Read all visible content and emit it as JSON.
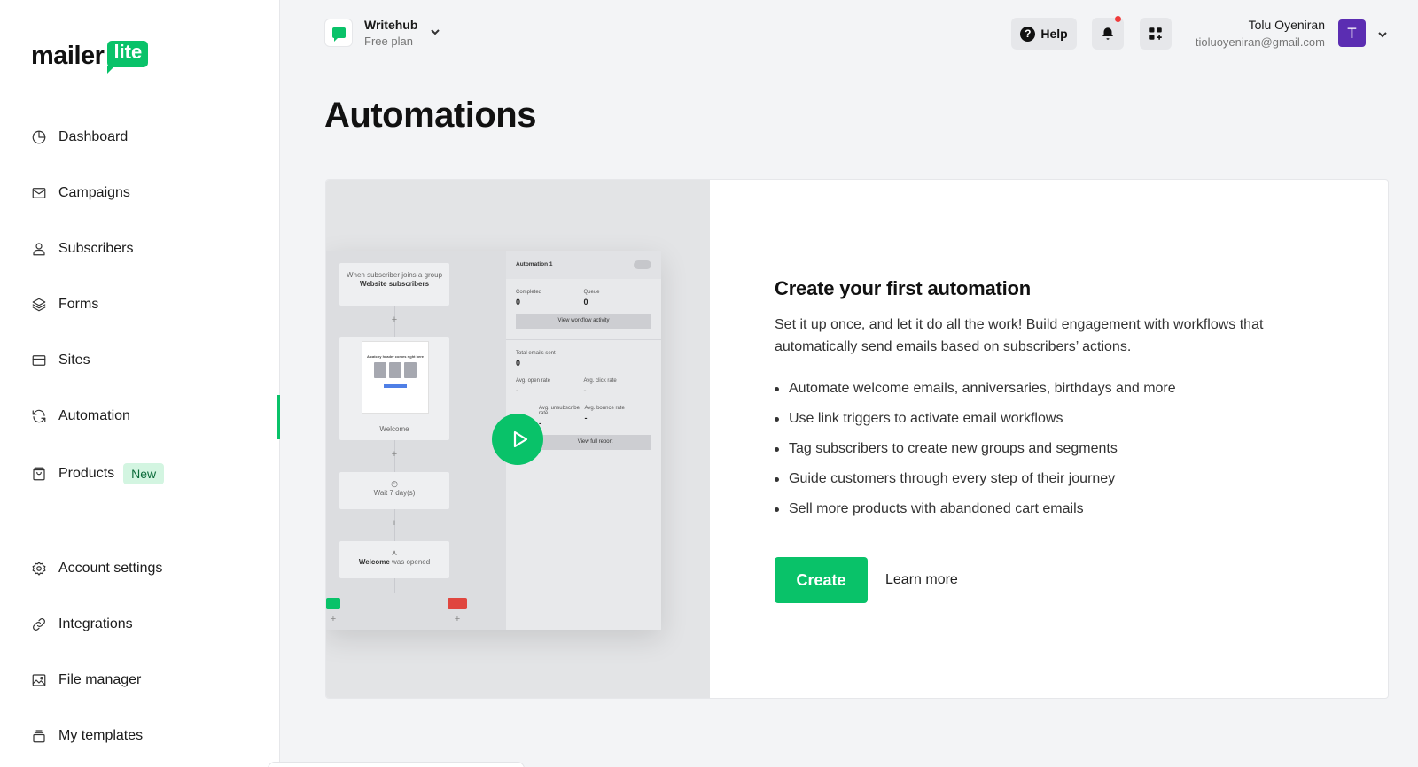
{
  "brand": {
    "word": "mailer",
    "badge": "lite",
    "accent": "#09c269"
  },
  "sidebar": {
    "items": [
      {
        "label": "Dashboard",
        "icon": "clock-pie-icon"
      },
      {
        "label": "Campaigns",
        "icon": "envelope-icon"
      },
      {
        "label": "Subscribers",
        "icon": "user-icon"
      },
      {
        "label": "Forms",
        "icon": "layers-icon"
      },
      {
        "label": "Sites",
        "icon": "browser-icon"
      },
      {
        "label": "Automation",
        "icon": "refresh-icon",
        "active": true
      },
      {
        "label": "Products",
        "icon": "shopping-bag-icon",
        "badge": "New"
      },
      {
        "label": "Account settings",
        "icon": "gear-icon"
      },
      {
        "label": "Integrations",
        "icon": "link-icon"
      },
      {
        "label": "File manager",
        "icon": "image-icon"
      },
      {
        "label": "My templates",
        "icon": "stack-icon"
      }
    ]
  },
  "header": {
    "account_name": "Writehub",
    "account_plan": "Free plan",
    "help_label": "Help",
    "user_name": "Tolu Oyeniran",
    "user_email": "tioluoyeniran@gmail.com",
    "avatar_initial": "T",
    "avatar_color": "#5b2db2"
  },
  "page": {
    "title": "Automations"
  },
  "preview": {
    "trigger_prefix": "When subscriber joins a group",
    "trigger_group": "Website subscribers",
    "email_title": "A catchy header comes right here",
    "email_label": "Welcome",
    "wait_label": "Wait",
    "wait_value": "7 day(s)",
    "condition_email": "Welcome",
    "condition_suffix": "was opened",
    "stats_title": "Automation 1",
    "completed_label": "Completed",
    "completed_value": "0",
    "queue_label": "Queue",
    "queue_value": "0",
    "activity_button": "View workflow activity",
    "total_sent_label": "Total emails sent",
    "total_sent_value": "0",
    "open_rate_label": "Avg. open rate",
    "open_rate_value": "-",
    "click_rate_label": "Avg. click rate",
    "click_rate_value": "-",
    "unsub_rate_label": "Avg. unsubscribe rate",
    "unsub_rate_value": "-",
    "bounce_rate_label": "Avg. bounce rate",
    "bounce_rate_value": "-",
    "report_button": "View full report"
  },
  "intro": {
    "heading": "Create your first automation",
    "description": "Set it up once, and let it do all the work! Build engagement with workflows that automatically send emails based on subscribers’ actions.",
    "bullets": [
      "Automate welcome emails, anniversaries, birthdays and more",
      "Use link triggers to activate email workflows",
      "Tag subscribers to create new groups and segments",
      "Guide customers through every step of their journey",
      "Sell more products with abandoned cart emails"
    ],
    "create_label": "Create",
    "learn_more_label": "Learn more"
  }
}
